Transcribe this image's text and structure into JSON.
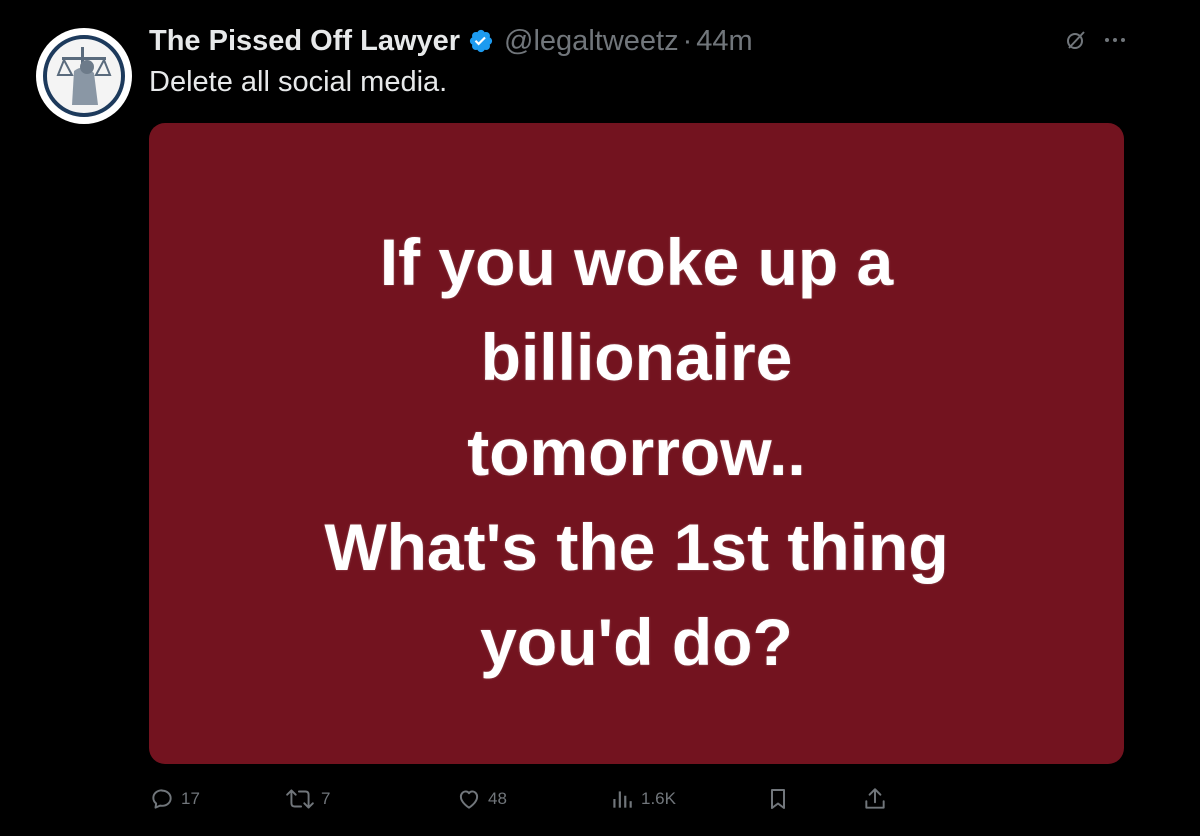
{
  "tweet": {
    "display_name": "The Pissed Off Lawyer",
    "handle": "@legaltweetz",
    "separator": "·",
    "time": "44m",
    "text": "Delete all social media.",
    "verified": true,
    "avatar_icon": "lady-justice-logo",
    "media": {
      "background_color": "#73131f",
      "lines": [
        "If you woke up a",
        "billionaire",
        "tomorrow..",
        "What's the 1st thing",
        "you'd do?"
      ]
    }
  },
  "icons": {
    "verified": "verified-badge-icon",
    "grok": "grok-icon",
    "more": "more-icon",
    "reply": "reply-icon",
    "repost": "repost-icon",
    "like": "like-icon",
    "views": "views-icon",
    "bookmark": "bookmark-icon",
    "share": "share-icon"
  },
  "actions": {
    "replies": "17",
    "reposts": "7",
    "likes": "48",
    "views": "1.6K"
  },
  "colors": {
    "background": "#000000",
    "text": "#e7e9ea",
    "muted": "#71767b",
    "verified": "#1d9bf0"
  }
}
